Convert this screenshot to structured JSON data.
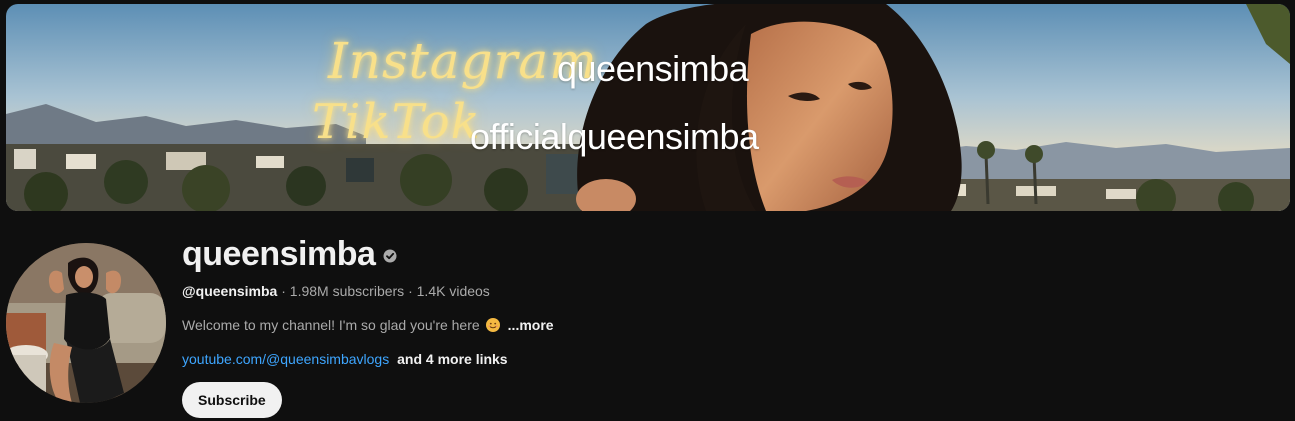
{
  "banner": {
    "instagram_label": "Instagram",
    "instagram_handle": "queensimba",
    "tiktok_label": "TikTok",
    "tiktok_handle": "officialqueensimba"
  },
  "channel": {
    "name": "queensimba",
    "verified": true,
    "handle": "@queensimba",
    "subscribers": "1.98M subscribers",
    "videos": "1.4K videos",
    "separator": " · ",
    "description": "Welcome to my channel! I'm so glad you're here",
    "description_emoji": "smiling-face-emoji",
    "more_label": "...more",
    "link": "youtube.com/@queensimbavlogs",
    "more_links": "and 4 more links",
    "subscribe_label": "Subscribe"
  },
  "colors": {
    "background": "#0f0f0f",
    "text_primary": "#f1f1f1",
    "text_secondary": "#aaaaaa",
    "link": "#3ea6ff",
    "subscribe_bg": "#f1f1f1",
    "banner_script": "#f8e08a"
  },
  "icons": {
    "verified": "verified-check-icon"
  }
}
